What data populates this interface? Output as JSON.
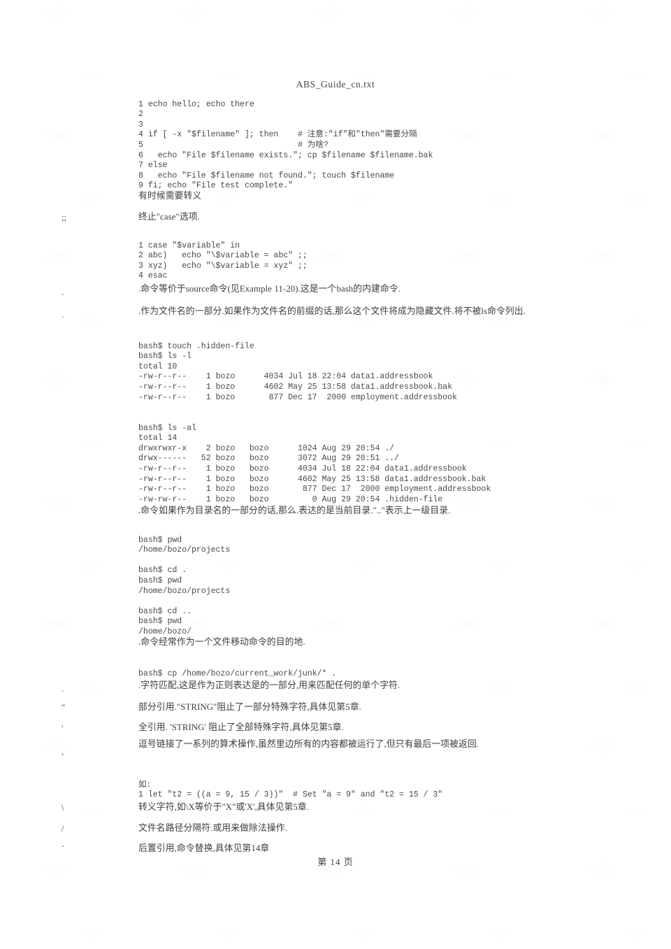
{
  "document": {
    "header_title": "ABS_Guide_cn.txt",
    "footer_page": "第 14 页"
  },
  "blocks": {
    "code_if_test": "1 echo hello; echo there\n2\n3\n4 if [ -x \"$filename\" ]; then    # 注意:\"if\"和\"then\"需要分隔\n5                                # 为啥?\n6   echo \"File $filename exists.\"; cp $filename $filename.bak\n7 else\n8   echo \"File $filename not found.\"; touch $filename\n9 fi; echo \"File test complete.\"",
    "escape_note": "有时候需要转义",
    "case_symbol": ";;",
    "case_desc": "终止\"case\"选项.",
    "code_case": "1 case \"$variable\" in\n2 abc)   echo \"\\$variable = abc\" ;;\n3 xyz)   echo \"\\$variable = xyz\" ;;\n4 esac",
    "dot_source_symbol": ".",
    "dot_source_desc": ".命令等价于source命令(见Example 11-20).这是一个bash的内建命令.",
    "dot_hidden_symbol": ".",
    "dot_hidden_desc": ".作为文件名的一部分.如果作为文件名的前缀的话,那么这个文件将成为隐藏文件.将不被ls命令列出.",
    "term_ls_l": "bash$ touch .hidden-file\nbash$ ls -l\ntotal 10\n-rw-r--r--    1 bozo      4034 Jul 18 22:04 data1.addressbook\n-rw-r--r--    1 bozo      4602 May 25 13:58 data1.addressbook.bak\n-rw-r--r--    1 bozo       877 Dec 17  2000 employment.addressbook",
    "term_ls_al": "bash$ ls -al\ntotal 14\ndrwxrwxr-x    2 bozo   bozo      1024 Aug 29 20:54 ./\ndrwx------   52 bozo   bozo      3072 Aug 29 20:51 ../\n-rw-r--r--    1 bozo   bozo      4034 Jul 18 22:04 data1.addressbook\n-rw-r--r--    1 bozo   bozo      4602 May 25 13:58 data1.addressbook.bak\n-rw-r--r--    1 bozo   bozo       877 Dec 17  2000 employment.addressbook\n-rw-rw-r--    1 bozo   bozo         0 Aug 29 20:54 .hidden-file",
    "dot_dir_desc": ".命令如果作为目录名的一部分的话,那么.表达的是当前目录.\"..\"表示上一级目录.",
    "term_pwd_cd": "bash$ pwd\n/home/bozo/projects\n\nbash$ cd .\nbash$ pwd\n/home/bozo/projects\n\nbash$ cd ..\nbash$ pwd\n/home/bozo/",
    "dot_dest_desc": ".命令经常作为一个文件移动命令的目的地.",
    "term_cp": "bash$ cp /home/bozo/current_work/junk/* .",
    "dot_regex_symbol": ".",
    "dot_regex_desc": ".字符匹配,这是作为正则表达是的一部分,用来匹配任何的单个字符.",
    "dquote_symbol": "\"",
    "dquote_desc": "部分引用.\"STRING\"阻止了一部分特殊字符,具体见第5章.",
    "squote_symbol": "'",
    "squote_desc": "全引用. 'STRING' 阻止了全部特殊字符,具体见第5章.",
    "comma_symbol": ",",
    "comma_desc": "逗号链接了一系列的算术操作,虽然里边所有的内容都被运行了,但只有最后一项被返回.",
    "code_let": "如:\n1 let \"t2 = ((a = 9, 15 / 3))\"  # Set \"a = 9\" and \"t2 = 15 / 3\"",
    "backslash_symbol": "\\",
    "backslash_desc": "转义字符,如\\X等价于\"X\"或'X',具体见第5章.",
    "slash_symbol": "/",
    "slash_desc": "文件名路径分隔符.或用来做除法操作.",
    "backtick_symbol": "`",
    "backtick_desc": "后置引用,命令替换,具体见第14章"
  }
}
